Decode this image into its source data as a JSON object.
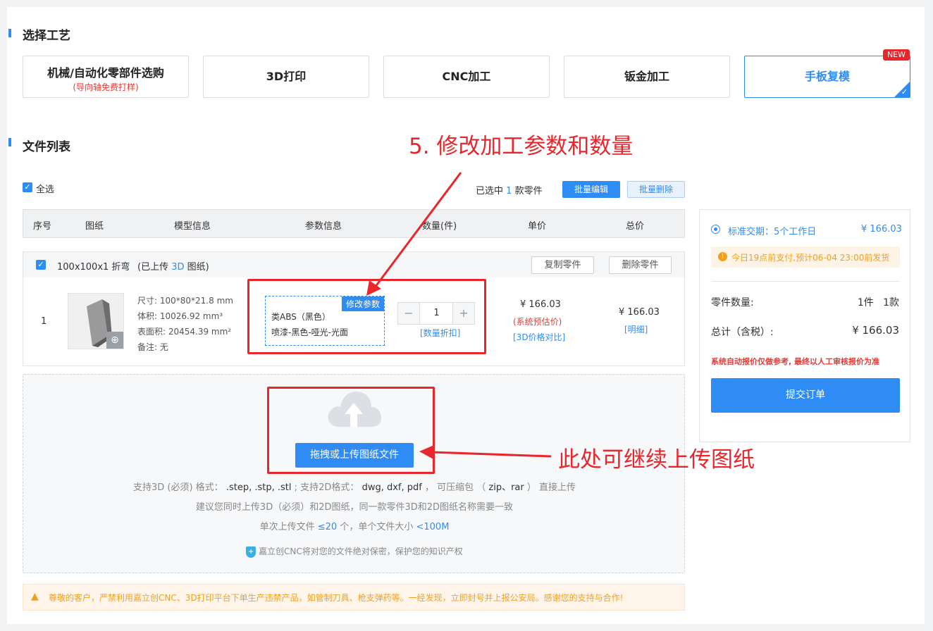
{
  "process_section": {
    "title": "选择工艺",
    "options": [
      {
        "name": "机械/自动化零部件选购",
        "sub": "(导向轴免费打样)"
      },
      {
        "name": "3D打印"
      },
      {
        "name": "CNC加工"
      },
      {
        "name": "钣金加工"
      },
      {
        "name": "手板复模",
        "badge": "NEW",
        "selected": true
      }
    ]
  },
  "file_section": {
    "title": "文件列表",
    "select_all": "全选",
    "selected_prefix": "已选中",
    "selected_count": "1",
    "selected_suffix": "款零件",
    "batch_edit": "批量编辑",
    "batch_delete": "批量删除"
  },
  "table": {
    "headers": [
      "序号",
      "图纸",
      "模型信息",
      "参数信息",
      "数量(件)",
      "单价",
      "总价"
    ]
  },
  "part": {
    "name": "100x100x1 折弯",
    "upload_prefix": "(已上传",
    "upload_type": "3D",
    "upload_suffix": "图纸)",
    "copy_button": "复制零件",
    "delete_button": "删除零件",
    "index": "1",
    "size": "尺寸: 100*80*21.8 mm",
    "volume": "体积: 10026.92 mm³",
    "area": "表面积: 20454.39 mm²",
    "note": "备注: 无",
    "edit_params": "修改参数",
    "material": "类ABS（黑色）",
    "finish": "喷漆-黑色-哑光-光面",
    "quantity": "1",
    "qty_discount": "[数量折扣]",
    "unit_price": "¥ 166.03",
    "estimate_label": "(系统预估价)",
    "compare_3d": "[3D价格对比]",
    "total_price": "¥ 166.03",
    "detail_link": "[明细]"
  },
  "upload": {
    "button": "拖拽或上传图纸文件",
    "line1_a": "支持3D (必须) 格式：",
    "line1_b": ".step, .stp, .stl",
    "line1_c": "; 支持2D格式：",
    "line1_d": "dwg, dxf, pdf",
    "line1_e": "， 可压缩包 （",
    "line1_f": "zip、rar",
    "line1_g": "） 直接上传",
    "line2": "建议您同时上传3D（必须）和2D图纸，同一款零件3D和2D图纸名称需要一致",
    "line3_a": "单次上传文件",
    "line3_b": "≤20",
    "line3_c": "个，单个文件大小",
    "line3_d": "<100M",
    "security": "嘉立创CNC将对您的文件绝对保密，保护您的知识产权"
  },
  "warning": "尊敬的客户，严禁利用嘉立创CNC、3D打印平台下单生产违禁产品，如管制刀具、枪支弹药等。一经发现，立即封号并上报公安局。感谢您的支持与合作!",
  "summary": {
    "delivery_label": "标准交期：",
    "delivery_value": "5个工作日",
    "delivery_price": "¥ 166.03",
    "notice": "今日19点前支付,预计06-04 23:00前发货",
    "qty_label": "零件数量:",
    "qty_value": "1件   1款",
    "total_label": "总计（含税）:",
    "total_value": "¥ 166.03",
    "disclaimer": "系统自动报价仅做参考, 最终以人工审核报价为准",
    "submit": "提交订单"
  },
  "annotations": {
    "step5": "5. 修改加工参数和数量",
    "upload_hint": "此处可继续上传图纸"
  },
  "colors": {
    "accent": "#2f8cf5",
    "annotation": "#e8262b",
    "warning": "#f0a020"
  }
}
